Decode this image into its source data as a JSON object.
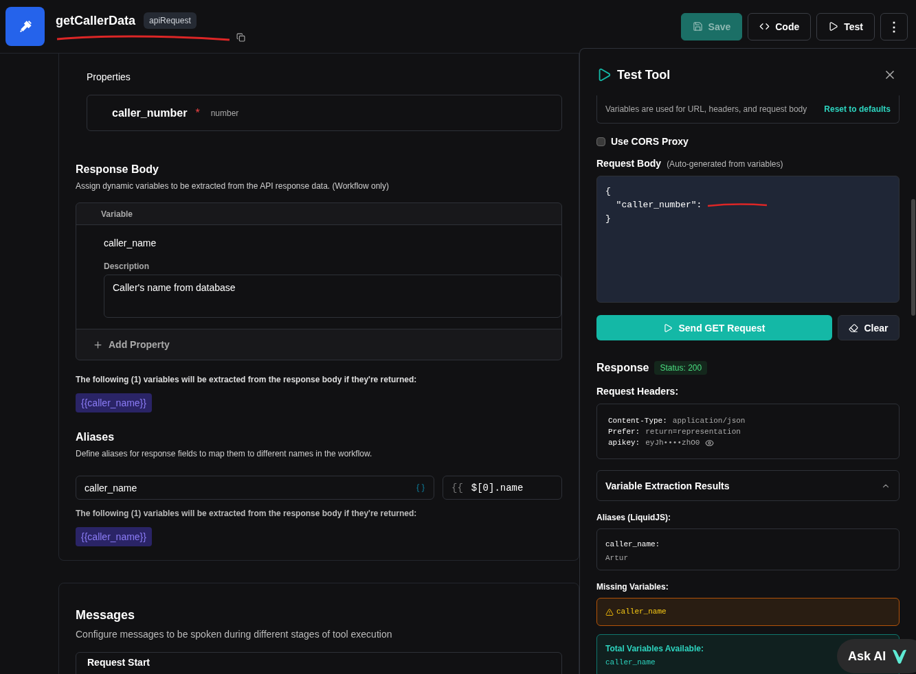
{
  "header": {
    "title": "getCallerData",
    "badge": "apiRequest",
    "buttons": [
      {
        "kind": "save",
        "label": "Save",
        "disabled": true
      },
      {
        "kind": "code",
        "label": "Code",
        "disabled": false
      },
      {
        "kind": "test",
        "label": "Test",
        "disabled": false
      },
      {
        "kind": "more",
        "label": "⋮",
        "disabled": false
      }
    ]
  },
  "main": {
    "properties_label": "Properties",
    "property": {
      "name": "caller_number",
      "required_mark": "*",
      "type": "number"
    },
    "response_body": {
      "title": "Response Body",
      "description": "Assign dynamic variables to be extracted from the API response data. (Workflow only)",
      "column": "Variable",
      "variable": "caller_name",
      "description_label": "Description",
      "description_value": "Caller's name from database",
      "add_button": "Add Property"
    },
    "extract_note": "The following (1) variables will be extracted from the response body if they're returned:",
    "chip": "{{caller_name}}",
    "aliases": {
      "title": "Aliases",
      "description": "Define aliases for response fields to map them to different names in the workflow.",
      "name_value": "caller_name",
      "brace": "{{",
      "path_value": "$[0].name"
    },
    "extract_note_2": "The following (1) variables will be extracted from the response body if they're returned:",
    "chip_2": "{{caller_name}}",
    "messages": {
      "title": "Messages",
      "description": "Configure messages to be spoken during different stages of tool execution",
      "first_item": "Request Start"
    }
  },
  "test_panel": {
    "title": "Test Tool",
    "variables_note": "Variables are used for URL, headers, and request body",
    "reset_link": "Reset to defaults",
    "cors": {
      "label": "Use CORS Proxy",
      "checked": false
    },
    "request_body": {
      "label": "Request Body",
      "hint": "(Auto-generated from variables)",
      "lines": [
        "{",
        "  \"caller_number\": ",
        "}"
      ]
    },
    "send_button": "Send GET Request",
    "clear_button": "Clear",
    "response": {
      "title": "Response",
      "status": "Status: 200"
    },
    "headers_label": "Request Headers:",
    "headers": [
      {
        "key": "Content-Type:",
        "value": "application/json",
        "masked": false
      },
      {
        "key": "Prefer:",
        "value": "return=representation",
        "masked": false
      },
      {
        "key": "apikey:",
        "value": "eyJh••••zhO0",
        "masked": true
      }
    ],
    "accordion": {
      "title": "Variable Extraction Results",
      "expanded": true
    },
    "aliases_label": "Aliases (LiquidJS):",
    "alias_key": "caller_name:",
    "alias_value": "Artur",
    "missing_label": "Missing Variables:",
    "missing": [
      "caller_name"
    ],
    "total_label": "Total Variables Available:",
    "total": [
      "caller_name"
    ]
  },
  "ask_ai": "Ask AI"
}
